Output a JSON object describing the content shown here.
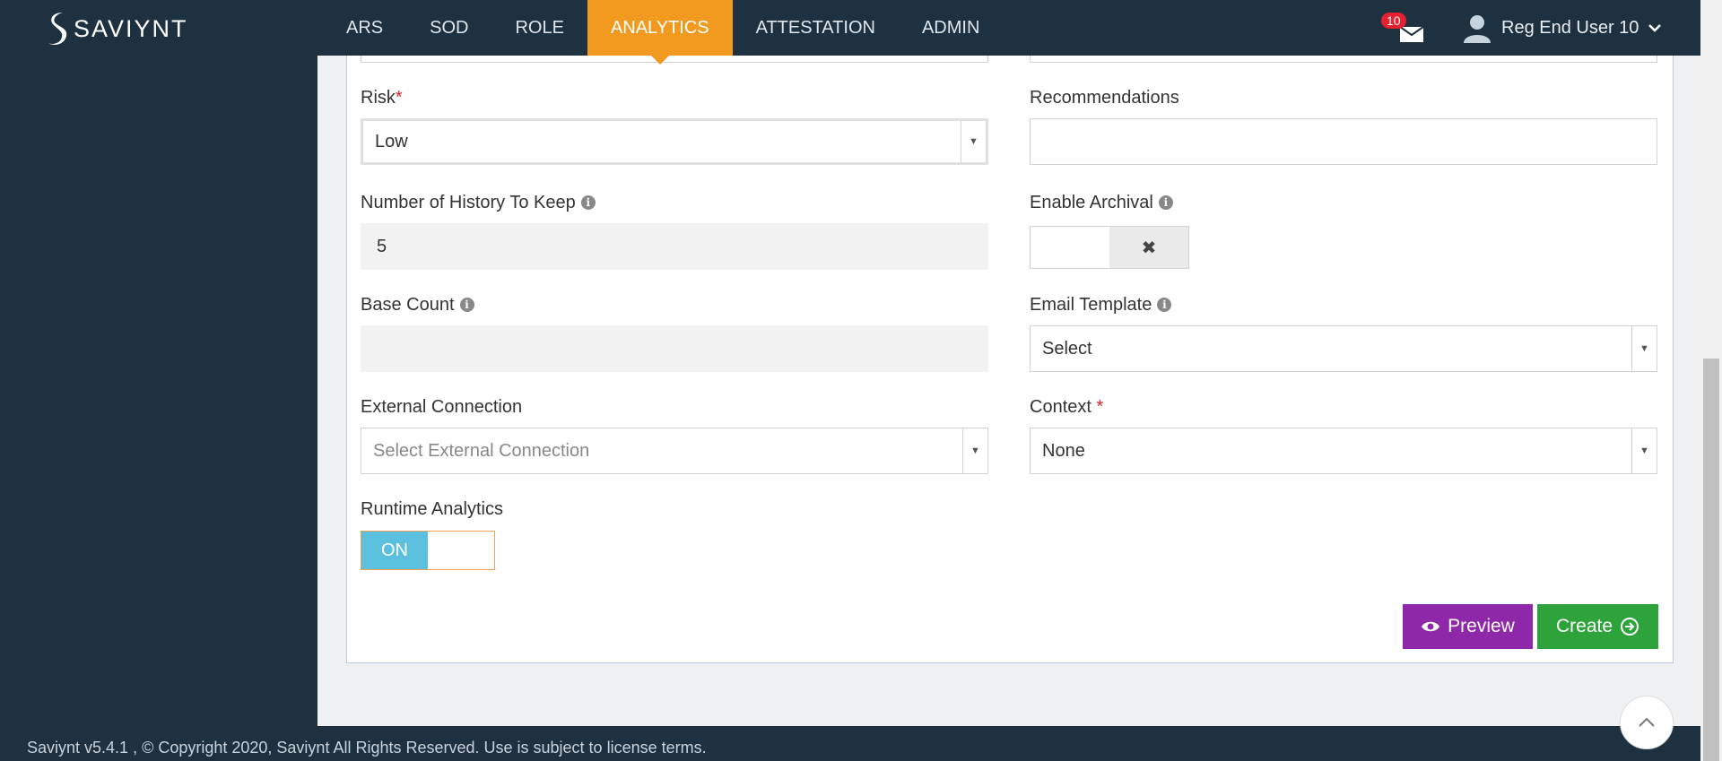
{
  "app": {
    "brand": "SAVIYNT",
    "nav": [
      "ARS",
      "SOD",
      "ROLE",
      "ANALYTICS",
      "ATTESTATION",
      "ADMIN"
    ],
    "active_nav": "ANALYTICS",
    "notifications_count": "10",
    "user_name": "Reg End User 10"
  },
  "form": {
    "risk_label": "Risk",
    "risk_required": "*",
    "risk_value": "Low",
    "recommendations_label": "Recommendations",
    "recommendations_value": "",
    "history_label": "Number of History To Keep",
    "history_value": "5",
    "archival_label": "Enable Archival",
    "archival_off_icon": "✖",
    "base_count_label": "Base Count",
    "base_count_value": "",
    "email_template_label": "Email Template",
    "email_template_value": "Select",
    "external_connection_label": "External Connection",
    "external_connection_placeholder": "Select External Connection",
    "context_label": "Context",
    "context_required": "*",
    "context_value": "None",
    "runtime_label": "Runtime Analytics",
    "runtime_state": "ON"
  },
  "actions": {
    "preview_label": "Preview",
    "create_label": "Create"
  },
  "footer": {
    "text": "Saviynt v5.4.1 , © Copyright  2020, Saviynt All Rights Reserved. Use is subject to license terms."
  },
  "icons": [
    "saviynt-logo-icon",
    "mail-icon",
    "user-avatar-icon",
    "chevron-down-icon",
    "info-icon",
    "eye-icon",
    "arrow-circle-right-icon",
    "chevron-up-icon"
  ],
  "colors": {
    "nav_active": "#f19a1f",
    "preview": "#8e28a8",
    "create": "#2ea33b",
    "toggle_on": "#5bc0de",
    "required": "#e02424"
  }
}
